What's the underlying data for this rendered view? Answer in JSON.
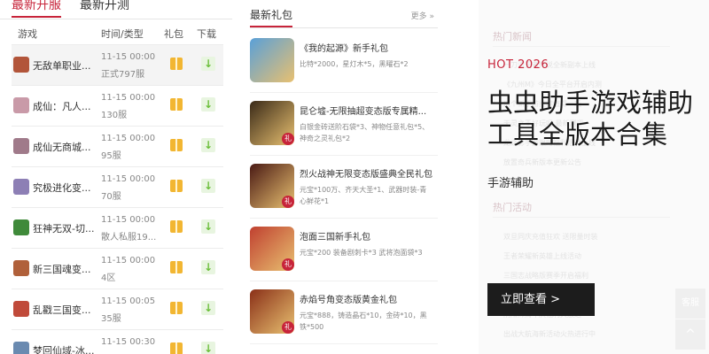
{
  "tabs": [
    "最新开服",
    "最新开测"
  ],
  "table_headers": {
    "game": "游戏",
    "time_type": "时间/类型",
    "gift": "礼包",
    "download": "下载"
  },
  "servers": [
    {
      "name": "无敌单职业...",
      "time": "11-15 00:00",
      "type": "正式797服",
      "color": "#b2553a"
    },
    {
      "name": "成仙：凡人...",
      "time": "11-15 00:00",
      "type": "130服",
      "color": "#c99aa8"
    },
    {
      "name": "成仙无商城...",
      "time": "11-15 00:00",
      "type": "95服",
      "color": "#a07a8a"
    },
    {
      "name": "究极进化变...",
      "time": "11-15 00:00",
      "type": "70服",
      "color": "#8d7fb5"
    },
    {
      "name": "狂神无双-切...",
      "time": "11-15 00:00",
      "type": "散人私服19...",
      "color": "#3f8a3a"
    },
    {
      "name": "新三国魂变...",
      "time": "11-15 00:00",
      "type": "4区",
      "color": "#b0603a"
    },
    {
      "name": "乱戳三国变...",
      "time": "11-15 00:05",
      "type": "35服",
      "color": "#c04a3a"
    },
    {
      "name": "梦回仙域-冰...",
      "time": "11-15 00:30",
      "type": "",
      "color": "#6a8ab0"
    }
  ],
  "gift_section": {
    "title": "最新礼包",
    "more": "更多 »"
  },
  "gifts": [
    {
      "title": "《我的起源》新手礼包",
      "desc": "比特*2000，星灯木*5，黑曜石*2",
      "color": "#5aa0d8",
      "badge": ""
    },
    {
      "title": "昆仑墟-无限抽超变态版专属精...",
      "desc": "白银金砖送阶石袋*3、神物任意礼包*5、神奇之灵礼包*2",
      "color": "#3a2a18",
      "badge": "礼"
    },
    {
      "title": "烈火战神无限变态版盛典全民礼包",
      "desc": "元宝*100万、齐天大圣*1、武器时装-青心鲜花*1",
      "color": "#4a1a14",
      "badge": "礼"
    },
    {
      "title": "泡面三国新手礼包",
      "desc": "元宝*200 装备剧刺卡*3 武将泡面袋*3",
      "color": "#c04030",
      "badge": "礼"
    },
    {
      "title": "赤焰号角变态版黄金礼包",
      "desc": "元宝*888，铸造晶石*10，金砖*10，黑铁*500",
      "color": "#8a3018",
      "badge": "礼"
    }
  ],
  "promo": {
    "kicker": "HOT 2026",
    "headline": "虫虫助手游戏辅助工具全版本合集",
    "subtitle": "手游辅助",
    "cta": "立即查看 >"
  },
  "background_panel": {
    "sections": [
      "热门新闻",
      "热门活动"
    ],
    "news": [
      "一刀流王者传说全新副本上线",
      "《九州M》今日全平台开启内测",
      "这个新手游推荐值得一玩",
      "天灵之王好玩吗 最新测评",
      "龙之影手游限时福利活动上线",
      "放置奇兵新版本更新公告"
    ],
    "events": [
      "双旦同庆充值狂欢 送限量时装",
      "王者荣耀新英雄上线活动",
      "三国志战略版赛季开启福利",
      "原神新版本限时活动开启",
      "阴阳师周年庆福利大放送",
      "出战大航海新活动火热进行中"
    ]
  },
  "float_buttons": [
    "客服",
    "^"
  ]
}
